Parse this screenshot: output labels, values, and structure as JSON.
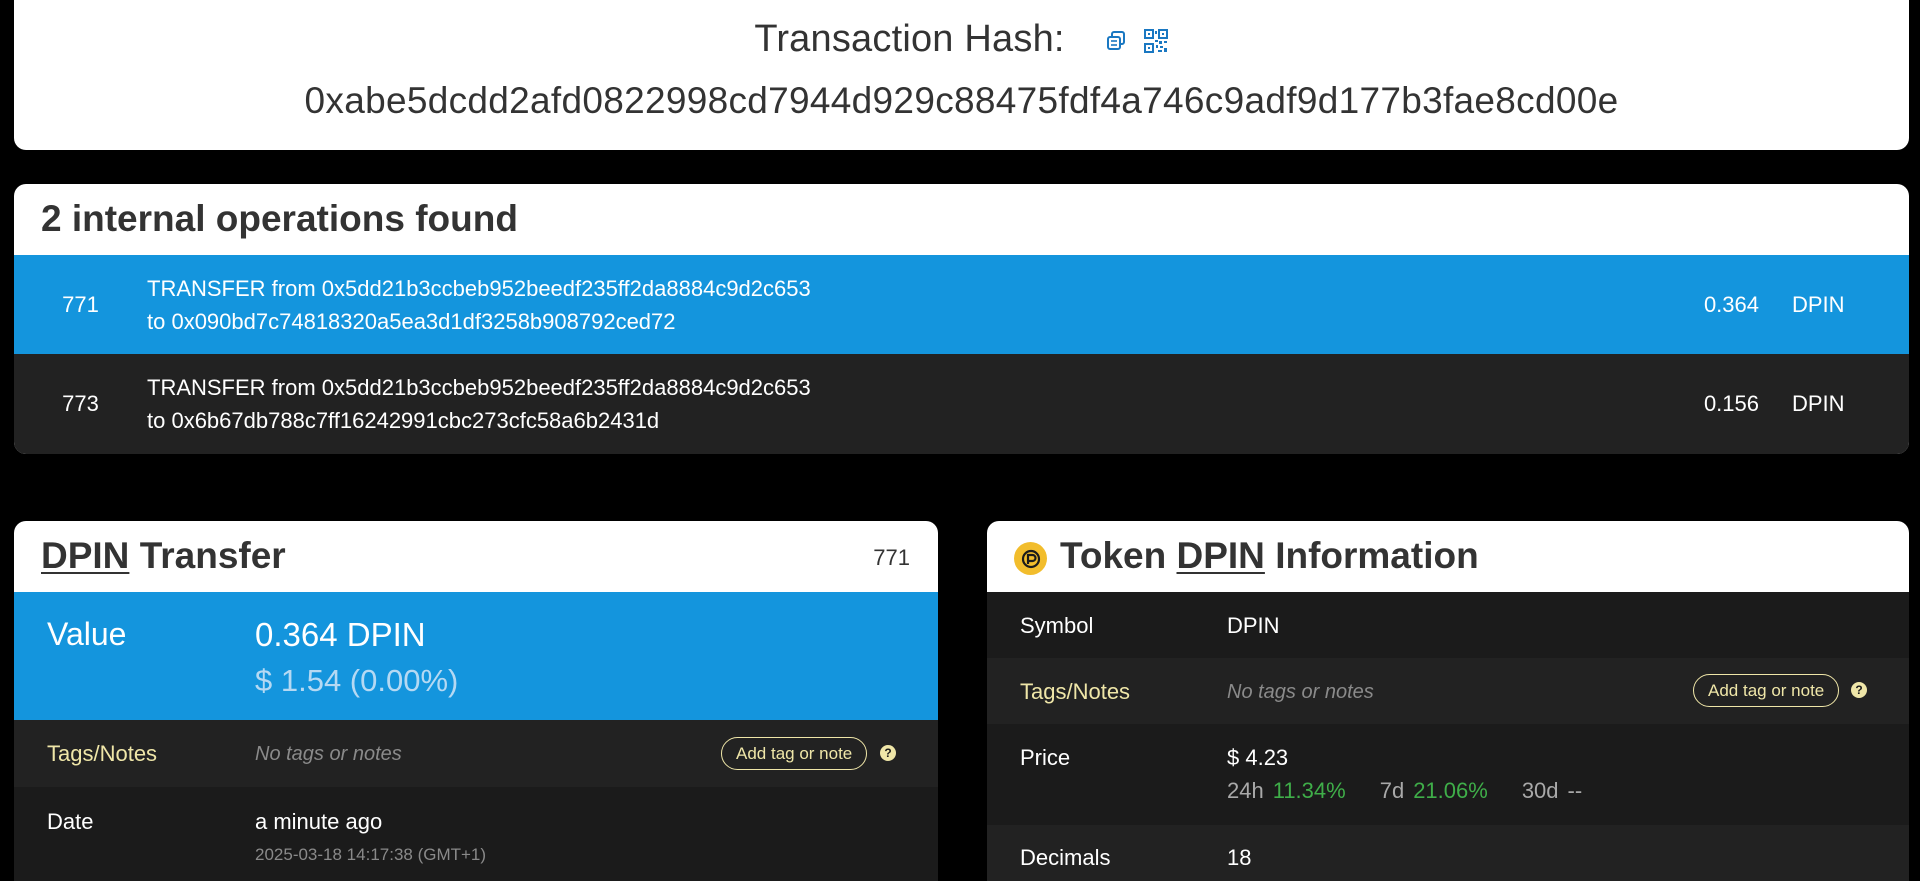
{
  "header": {
    "title": "Transaction Hash:",
    "hash": "0xabe5dcdd2afd0822998cd7944d929c88475fdf4a746c9adf9d177b3fae8cd00e",
    "icons": [
      "copy-icon",
      "qr-code-icon"
    ]
  },
  "operations": {
    "title": "2 internal operations found",
    "rows": [
      {
        "id": "771",
        "line1": "TRANSFER from 0x5dd21b3ccbeb952beedf235ff2da8884c9d2c653",
        "line2": "to 0x090bd7c74818320a5ea3d1df3258b908792ced72",
        "amount": "0.364",
        "symbol": "DPIN"
      },
      {
        "id": "773",
        "line1": "TRANSFER from 0x5dd21b3ccbeb952beedf235ff2da8884c9d2c653",
        "line2": "to 0x6b67db788c7ff16242991cbc273cfc58a6b2431d",
        "amount": "0.156",
        "symbol": "DPIN"
      }
    ]
  },
  "transfer": {
    "token": "DPIN",
    "title_suffix": "Transfer",
    "counter": "771",
    "value_label": "Value",
    "value": "0.364 DPIN",
    "value_usd": "$ 1.54 (0.00%)",
    "tags_label": "Tags/Notes",
    "tags_value": "No tags or notes",
    "add_tag": "Add tag or note",
    "date_label": "Date",
    "date_relative": "a minute ago",
    "date_full": "2025-03-18 14:17:38 (GMT+1)"
  },
  "token_info": {
    "title_prefix": "Token",
    "token": "DPIN",
    "title_suffix": "Information",
    "symbol_label": "Symbol",
    "symbol_value": "DPIN",
    "tags_label": "Tags/Notes",
    "tags_value": "No tags or notes",
    "add_tag": "Add tag or note",
    "price_label": "Price",
    "price_value": "$ 4.23",
    "change_24h_label": "24h",
    "change_24h": "11.34%",
    "change_7d_label": "7d",
    "change_7d": "21.06%",
    "change_30d_label": "30d",
    "change_30d": "--",
    "decimals_label": "Decimals",
    "decimals_value": "18"
  },
  "colors": {
    "accent_blue": "#1495dd",
    "tag_yellow": "#efe6a8",
    "positive_green": "#3fae49",
    "token_gold": "#f2bd2c"
  }
}
